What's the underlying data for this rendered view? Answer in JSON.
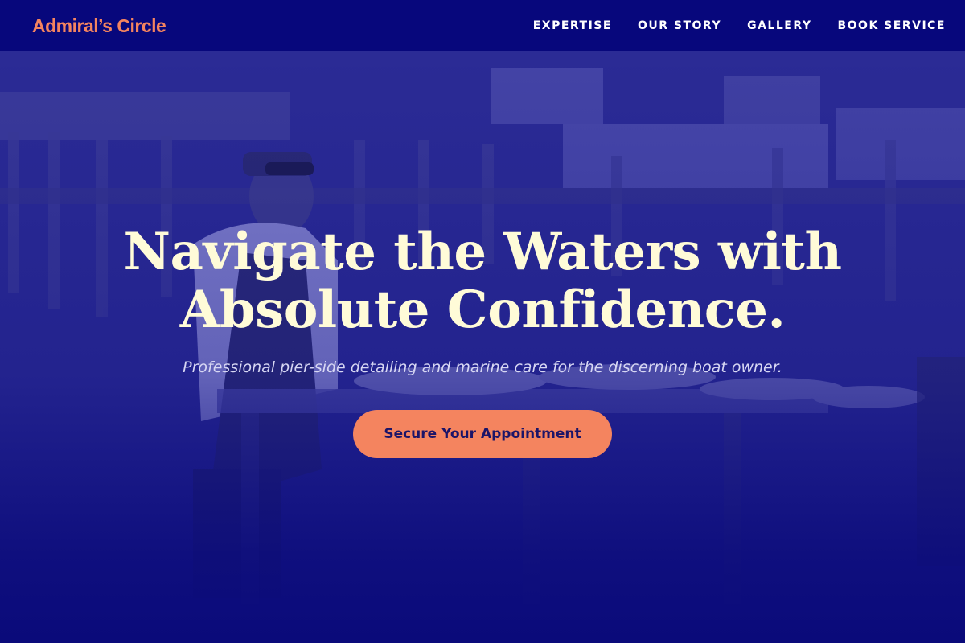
{
  "brand": {
    "name": "Admiral’s Circle"
  },
  "nav": {
    "items": [
      {
        "label": "EXPERTISE"
      },
      {
        "label": "OUR STORY"
      },
      {
        "label": "GALLERY"
      },
      {
        "label": "BOOK SERVICE"
      }
    ]
  },
  "hero": {
    "title": "Navigate the Waters with Absolute Confidence.",
    "subtitle": "Professional pier-side detailing and marine care for the discerning boat owner.",
    "cta_label": "Secure Your Appointment",
    "image": {
      "icon": "photo-fisherman-pier-icon"
    }
  },
  "colors": {
    "nav_background": "#07077c",
    "brand": "#f4845f",
    "hero_overlay": "#0a0a7a",
    "title": "#fffbd8",
    "cta_background": "#f4845f",
    "cta_text": "#1b1468"
  }
}
